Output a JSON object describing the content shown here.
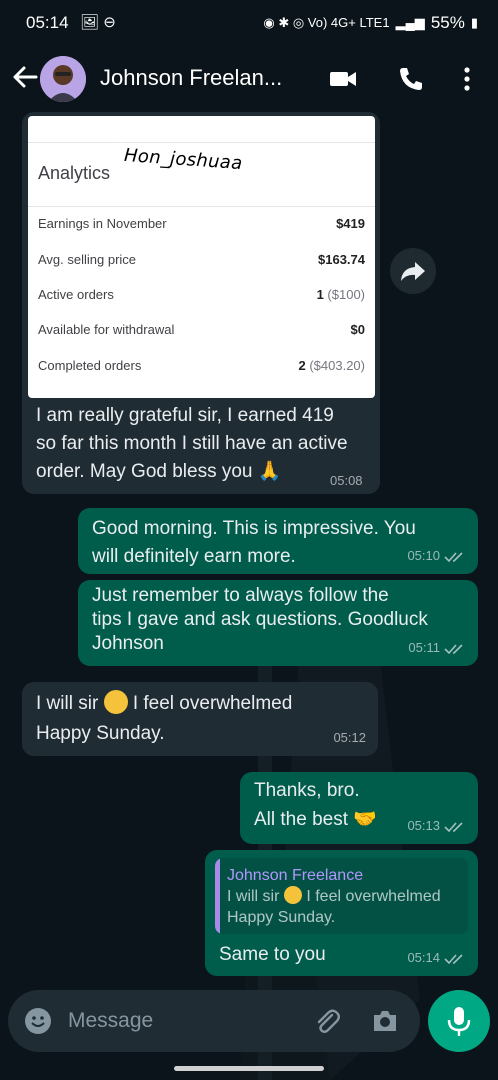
{
  "status_bar": {
    "time": "05:14",
    "left_icons": "🖼 ⊖",
    "right_icons": "◉ ✱ ◎ Vo) 4G+ LTE1",
    "battery": "55%"
  },
  "header": {
    "contact_name": "Johnson Freelan...",
    "icons": [
      "back-arrow-icon",
      "video-call-icon",
      "phone-icon",
      "more-options-icon"
    ]
  },
  "analytics_card": {
    "title": "Analytics",
    "watermark": "Hon_joshuaa",
    "rows": [
      {
        "label": "Earnings in November",
        "value": "$419",
        "sub": ""
      },
      {
        "label": "Avg. selling price",
        "value": "$163.74",
        "sub": ""
      },
      {
        "label": "Active orders",
        "value": "1",
        "sub": "($100)"
      },
      {
        "label": "Available for withdrawal",
        "value": "$0",
        "sub": ""
      },
      {
        "label": "Completed orders",
        "value": "2",
        "sub": "($403.20)"
      }
    ]
  },
  "messages": [
    {
      "dir": "in",
      "text": "I am really grateful sir, I earned 419\nso far this month I still have an active\norder. May God bless you 🙏",
      "time": "05:08"
    },
    {
      "dir": "out",
      "text": "Good morning. This is impressive. You\nwill definitely earn more.",
      "time": "05:10"
    },
    {
      "dir": "out",
      "text": "Just remember to always follow the\ntips I gave and ask questions. Goodluck\nJohnson",
      "time": "05:11"
    },
    {
      "dir": "in",
      "text_before": "I will sir ",
      "text_after": " I feel overwhelmed\nHappy Sunday.",
      "time": "05:12"
    },
    {
      "dir": "out",
      "text": "Thanks, bro.\nAll the best 🤝",
      "time": "05:13"
    },
    {
      "dir": "out",
      "quote_name": "Johnson Freelance",
      "quote_before": "I will sir ",
      "quote_after": " I feel overwhelmed\nHappy Sunday.",
      "text": "Same to you",
      "time": "05:14"
    }
  ],
  "input": {
    "placeholder": "Message"
  },
  "colors": {
    "incoming_bubble": "#202c33",
    "outgoing_bubble": "#005c4b",
    "accent": "#00a884"
  }
}
